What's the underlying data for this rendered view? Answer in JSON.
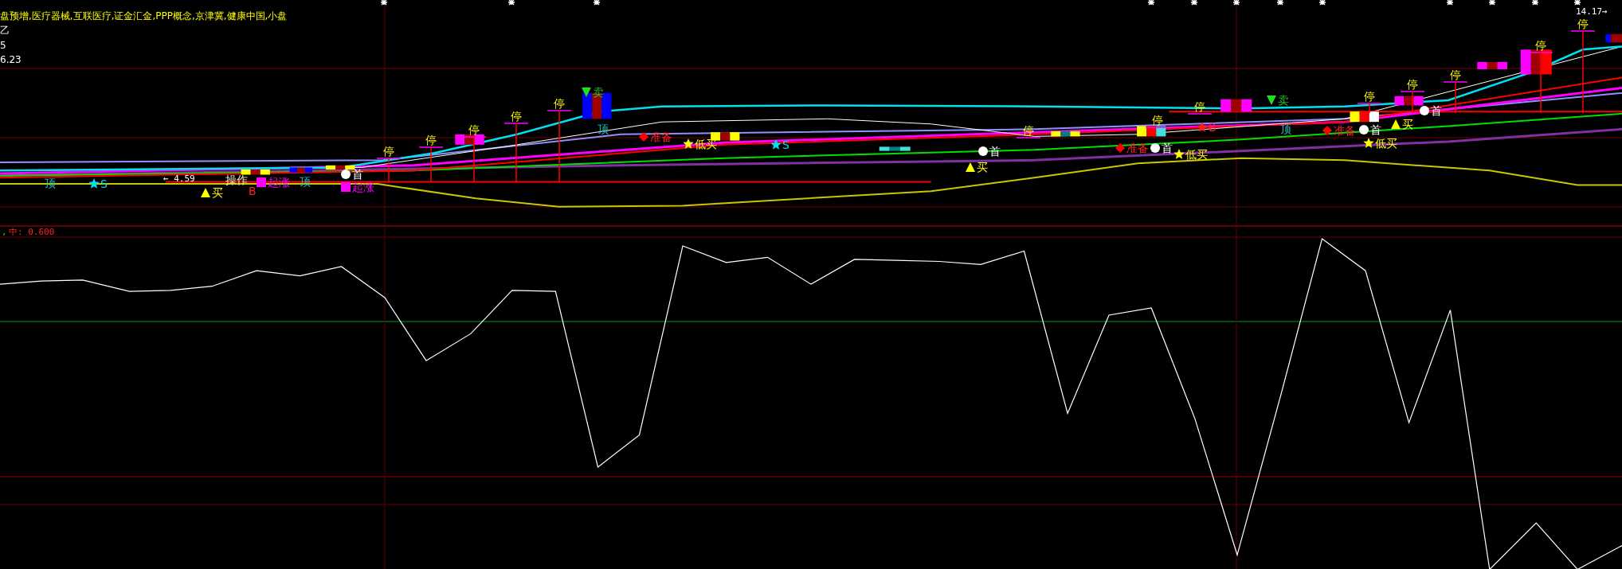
{
  "header": {
    "sectors": "盘预增,医疗器械,互联医疗,证金汇金,PPP概念,京津冀,健康中国,小盘",
    "lines": [
      "乙",
      "5",
      "6.23"
    ]
  },
  "price_pane": {
    "price_tags": [
      {
        "kind": "low",
        "text": "← 4.59"
      },
      {
        "kind": "high",
        "text": "14.17→"
      }
    ],
    "signals": [
      {
        "kind": "top",
        "text": "顶"
      },
      {
        "kind": "star_s",
        "text": "S"
      },
      {
        "kind": "buy",
        "text": "买"
      },
      {
        "kind": "op",
        "text": "操作"
      },
      {
        "kind": "b",
        "text": "B"
      },
      {
        "kind": "rise",
        "text": "起涨"
      },
      {
        "kind": "top",
        "text": "顶"
      },
      {
        "kind": "first",
        "text": "首"
      },
      {
        "kind": "rise",
        "text": "起涨"
      },
      {
        "kind": "stop",
        "text": "停"
      },
      {
        "kind": "stop",
        "text": "停"
      },
      {
        "kind": "stop",
        "text": "停"
      },
      {
        "kind": "stop",
        "text": "停"
      },
      {
        "kind": "stop",
        "text": "停"
      },
      {
        "kind": "sell",
        "text": "卖"
      },
      {
        "kind": "top",
        "text": "顶"
      },
      {
        "kind": "prepare",
        "text": "准备"
      },
      {
        "kind": "low_buy",
        "text": "低买"
      },
      {
        "kind": "star_s",
        "text": "S"
      },
      {
        "kind": "first",
        "text": "首"
      },
      {
        "kind": "buy",
        "text": "买"
      },
      {
        "kind": "stop",
        "text": "停"
      },
      {
        "kind": "prepare",
        "text": "准备"
      },
      {
        "kind": "first",
        "text": "首"
      },
      {
        "kind": "low_buy",
        "text": "低买"
      },
      {
        "kind": "stop",
        "text": "停"
      },
      {
        "kind": "stop",
        "text": "停"
      },
      {
        "kind": "star_b",
        "text": "B"
      },
      {
        "kind": "sell",
        "text": "卖"
      },
      {
        "kind": "top",
        "text": "顶"
      },
      {
        "kind": "prepare",
        "text": "准备"
      },
      {
        "kind": "stop",
        "text": "停"
      },
      {
        "kind": "first",
        "text": "首"
      },
      {
        "kind": "low_buy",
        "text": "低买"
      },
      {
        "kind": "buy",
        "text": "买"
      },
      {
        "kind": "first",
        "text": "首"
      },
      {
        "kind": "stop",
        "text": "停"
      },
      {
        "kind": "stop",
        "text": "停"
      },
      {
        "kind": "stop",
        "text": "停"
      },
      {
        "kind": "stop",
        "text": "停"
      }
    ]
  },
  "indicator_pane": {
    "legend_prefix": ",",
    "legend": "中: 0.600"
  }
}
